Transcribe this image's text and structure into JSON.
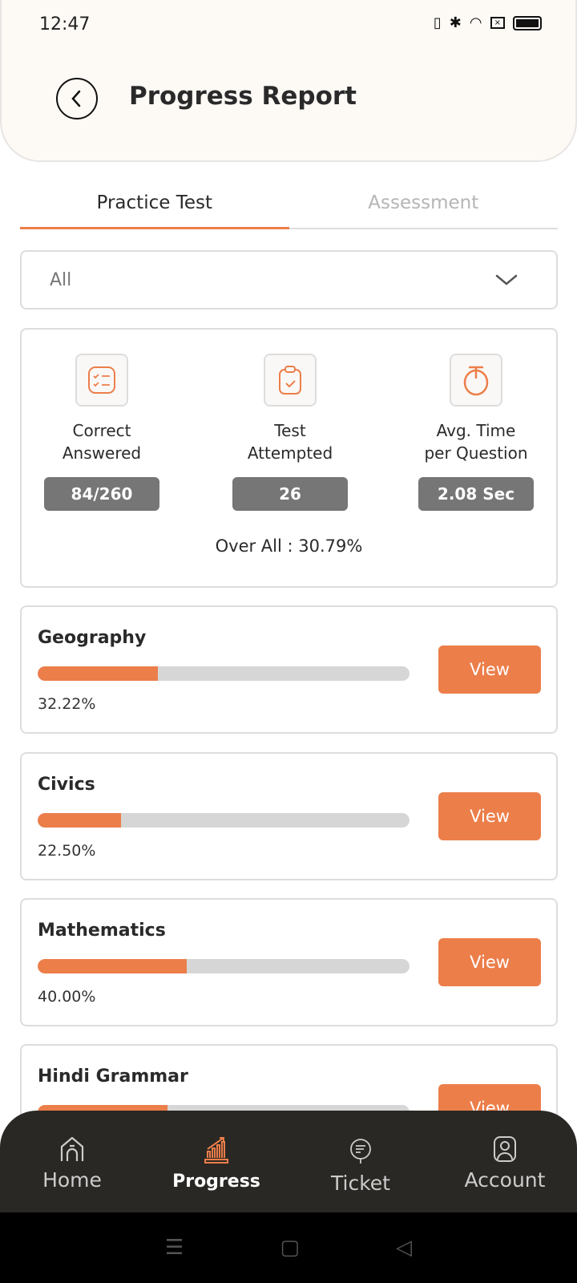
{
  "status_bar": {
    "time": "12:47",
    "icons": [
      "vibrate-icon",
      "bluetooth-icon",
      "wifi-icon",
      "sim-icon",
      "battery-icon"
    ]
  },
  "header": {
    "title": "Progress Report",
    "back_icon": "chevron-left-circle-icon"
  },
  "tabs": [
    {
      "label": "Practice Test",
      "active": true
    },
    {
      "label": "Assessment",
      "active": false
    }
  ],
  "filter": {
    "selected": "All"
  },
  "stats": {
    "items": [
      {
        "label_line1": "Correct",
        "label_line2": "Answered",
        "value": "84/260",
        "icon": "checklist-icon"
      },
      {
        "label_line1": "Test",
        "label_line2": "Attempted",
        "value": "26",
        "icon": "clipboard-check-icon"
      },
      {
        "label_line1": "Avg. Time",
        "label_line2": "per Question",
        "value": "2.08 Sec",
        "icon": "stopwatch-icon"
      }
    ],
    "overall": "Over All : 30.79%"
  },
  "subjects": [
    {
      "name": "Geography",
      "percent_label": "32.22%",
      "progress": 32.22,
      "button": "View"
    },
    {
      "name": "Civics",
      "percent_label": "22.50%",
      "progress": 22.5,
      "button": "View"
    },
    {
      "name": "Mathematics",
      "percent_label": "40.00%",
      "progress": 40.0,
      "button": "View"
    },
    {
      "name": "Hindi Grammar",
      "progress": 35,
      "button": "View"
    }
  ],
  "bottom_nav": [
    {
      "label": "Home",
      "icon": "home-icon",
      "active": false
    },
    {
      "label": "Progress",
      "icon": "chart-icon",
      "active": true
    },
    {
      "label": "Ticket",
      "icon": "support-icon",
      "active": false
    },
    {
      "label": "Account",
      "icon": "account-icon",
      "active": false
    }
  ],
  "colors": {
    "accent": "#ec7e4a",
    "pill": "#767676",
    "nav_bg": "#2a2824",
    "header_bg": "#fdf9f5"
  }
}
